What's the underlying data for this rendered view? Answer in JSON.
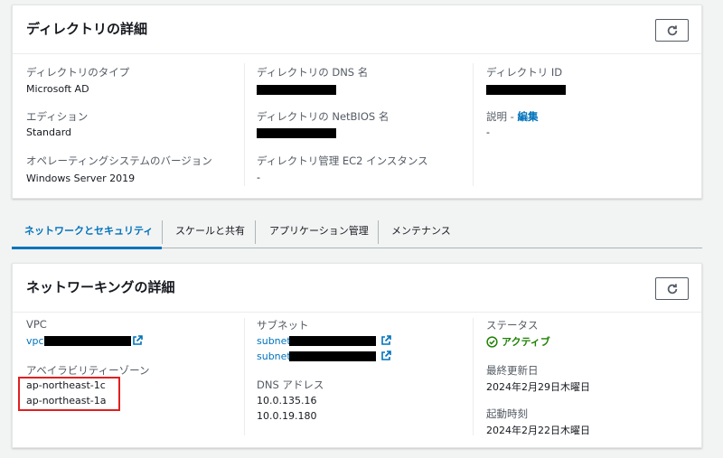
{
  "directory_panel": {
    "title": "ディレクトリの詳細",
    "fields": {
      "type_label": "ディレクトリのタイプ",
      "type_value": "Microsoft AD",
      "edition_label": "エディション",
      "edition_value": "Standard",
      "os_label": "オペレーティングシステムのバージョン",
      "os_value": "Windows Server 2019",
      "dns_name_label": "ディレクトリの DNS 名",
      "netbios_label": "ディレクトリの NetBIOS 名",
      "ec2_label": "ディレクトリ管理 EC2 インスタンス",
      "ec2_value": "-",
      "dir_id_label": "ディレクトリ ID",
      "desc_label": "説明 - ",
      "desc_edit_link": "編集",
      "desc_value": "-"
    }
  },
  "tabs": [
    {
      "label": "ネットワークとセキュリティ",
      "active": true
    },
    {
      "label": "スケールと共有",
      "active": false
    },
    {
      "label": "アプリケーション管理",
      "active": false
    },
    {
      "label": "メンテナンス",
      "active": false
    }
  ],
  "network_panel": {
    "title": "ネットワーキングの詳細",
    "fields": {
      "vpc_label": "VPC",
      "vpc_prefix": "vpc-",
      "az_label": "アベイラビリティーゾーン",
      "az_values": [
        "ap-northeast-1c",
        "ap-northeast-1a"
      ],
      "subnet_label": "サブネット",
      "subnet_prefixes": [
        "subnet-",
        "subnet-"
      ],
      "dns_label": "DNS アドレス",
      "dns_values": [
        "10.0.135.16",
        "10.0.19.180"
      ],
      "status_label": "ステータス",
      "status_value": "アクティブ",
      "updated_label": "最終更新日",
      "updated_value": "2024年2月29日木曜日",
      "launched_label": "起動時刻",
      "launched_value": "2024年2月22日木曜日"
    }
  },
  "colors": {
    "link": "#0073bb",
    "success": "#1d8102",
    "highlight": "#e02020"
  },
  "icons": [
    "refresh-icon",
    "external-link-icon",
    "status-check-icon"
  ]
}
